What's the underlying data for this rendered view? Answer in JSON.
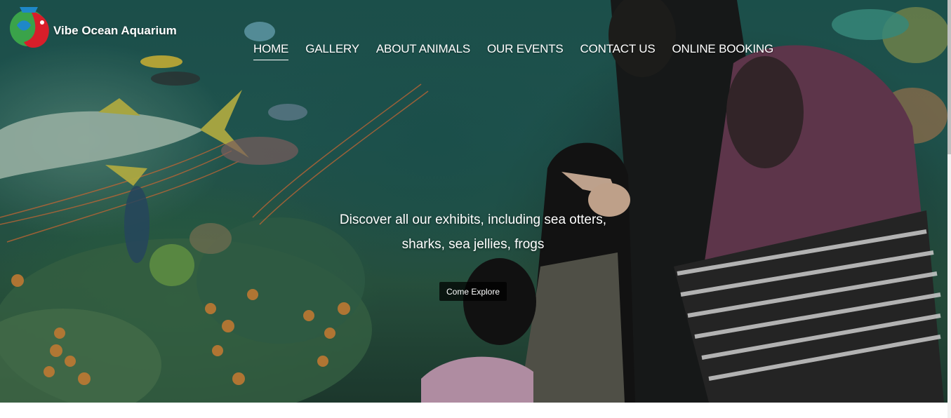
{
  "brand": {
    "name": "Vibe Ocean Aquarium",
    "logo_icon": "fish-logo-icon"
  },
  "nav": {
    "items": [
      {
        "label": "HOME",
        "active": true
      },
      {
        "label": "GALLERY",
        "active": false
      },
      {
        "label": "ABOUT ANIMALS",
        "active": false
      },
      {
        "label": "OUR EVENTS",
        "active": false
      },
      {
        "label": "CONTACT US",
        "active": false
      },
      {
        "label": "ONLINE BOOKING",
        "active": false
      }
    ]
  },
  "hero": {
    "tagline": "Discover all our exhibits, including sea otters, sharks, sea jellies, frogs",
    "cta_label": "Come Explore",
    "background_image": "aquarium-family-photo"
  },
  "colors": {
    "nav_text": "#ffffff",
    "cta_background": "#000000",
    "logo_red": "#d81e2a",
    "logo_green": "#3aa34a",
    "logo_blue": "#1e88c8"
  }
}
